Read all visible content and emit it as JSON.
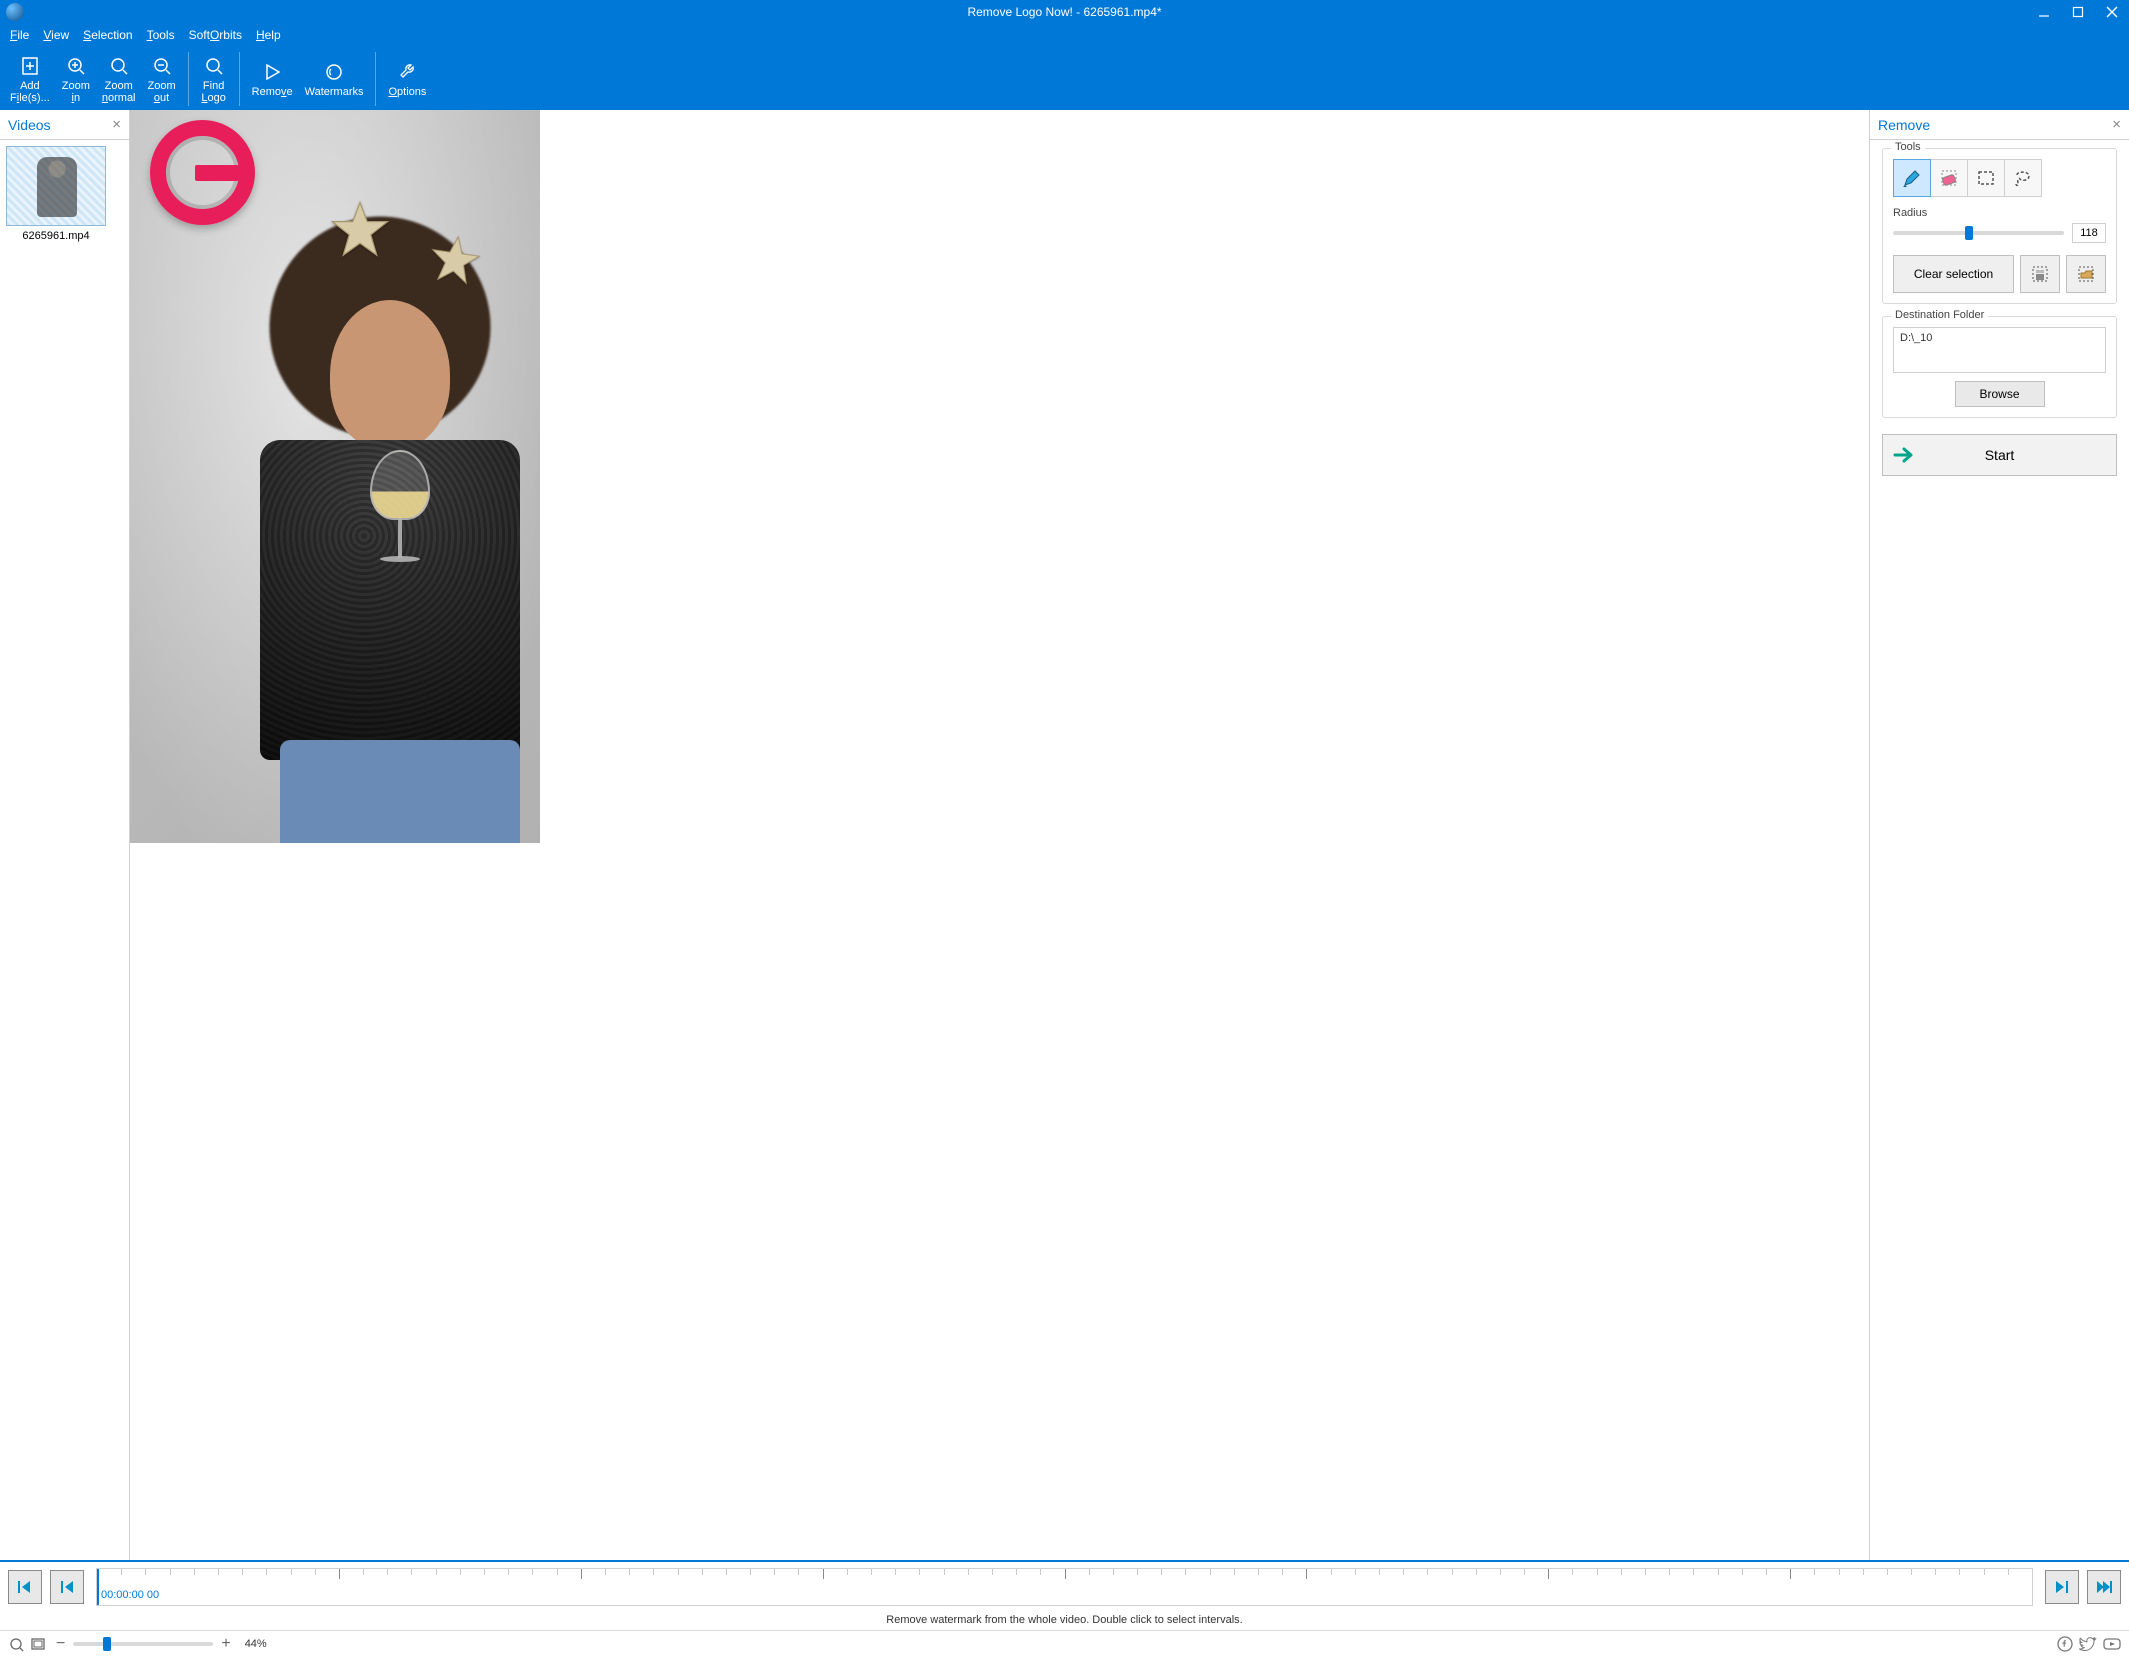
{
  "window": {
    "title": "Remove Logo Now! - 6265961.mp4*"
  },
  "menubar": {
    "file": "File",
    "view": "View",
    "selection": "Selection",
    "tools": "Tools",
    "softorbits": "SoftOrbits",
    "help": "Help"
  },
  "toolbar": {
    "add_files": "Add File(s)...",
    "zoom_in": "Zoom in",
    "zoom_normal": "Zoom normal",
    "zoom_out": "Zoom out",
    "find_logo": "Find Logo",
    "remove": "Remove",
    "watermarks": "Watermarks",
    "options": "Options"
  },
  "videos_panel": {
    "title": "Videos",
    "items": [
      {
        "name": "6265961.mp4"
      }
    ]
  },
  "remove_panel": {
    "title": "Remove",
    "tools_legend": "Tools",
    "radius_label": "Radius",
    "radius_value": "118",
    "clear_selection": "Clear selection",
    "dest_legend": "Destination Folder",
    "dest_path": "D:\\_10",
    "browse": "Browse",
    "start": "Start"
  },
  "timeline": {
    "timecode": "00:00:00 00",
    "hint": "Remove watermark from the whole video. Double click to select intervals."
  },
  "statusbar": {
    "zoom_percent": "44%"
  }
}
